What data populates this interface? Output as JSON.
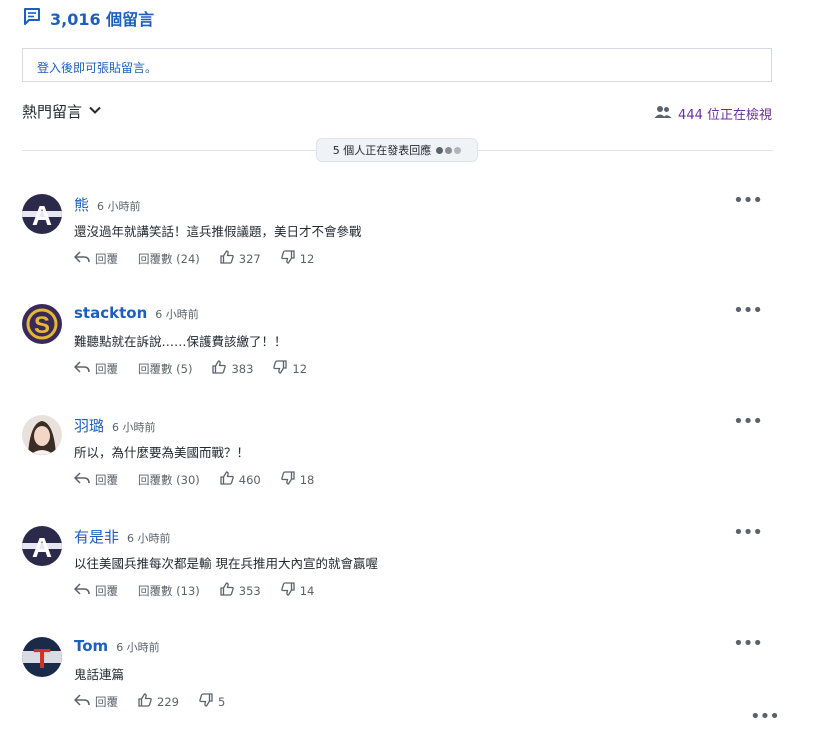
{
  "header": {
    "comment_count": "3,016 個留言"
  },
  "login_prompt": "登入後即可張貼留言。",
  "sort": {
    "label": "熱門留言"
  },
  "viewers": {
    "text": "444 位正在檢視"
  },
  "typing": {
    "text": "5 個人正在發表回應"
  },
  "actions": {
    "reply": "回覆"
  },
  "comments": [
    {
      "name": "熊",
      "time": "6 小時前",
      "text": "還沒過年就講笑話！這兵推假議題，美日才不會參戰",
      "replies": "回覆數 (24)",
      "likes": "327",
      "dislikes": "12"
    },
    {
      "name": "stackton",
      "time": "6 小時前",
      "text": "難聽點就在訴說……保護費該繳了！！",
      "replies": "回覆數 (5)",
      "likes": "383",
      "dislikes": "12"
    },
    {
      "name": "羽璐",
      "time": "6 小時前",
      "text": "所以，為什麼要為美國而戰？！",
      "replies": "回覆數 (30)",
      "likes": "460",
      "dislikes": "18"
    },
    {
      "name": "有是非",
      "time": "6 小時前",
      "text": "以往美國兵推每次都是輸 現在兵推用大內宣的就會贏喔",
      "replies": "回覆數 (13)",
      "likes": "353",
      "dislikes": "14"
    },
    {
      "name": "Tom",
      "time": "6 小時前",
      "text": "鬼話連篇",
      "likes": "229",
      "dislikes": "5"
    }
  ],
  "avatars": {
    "A": "A",
    "S": "S",
    "T": "T"
  },
  "colors": {
    "link_blue": "#1d5fbf",
    "viewer_purple": "#6b2ea0",
    "avatar_a_bg": "#2b2a4a",
    "avatar_s_bg": "#3a2a5a",
    "avatar_s_letter": "#e8b630",
    "avatar_t_bg": "#1c2a4a",
    "avatar_t_letter": "#d0302a"
  }
}
